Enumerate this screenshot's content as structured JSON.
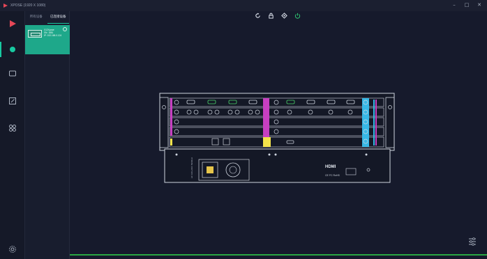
{
  "window": {
    "title": "XPOSE (1920 X 1080)",
    "controls": [
      "–",
      "□",
      "✕"
    ]
  },
  "colors": {
    "accent": "#18c9a1",
    "card": "#1ea88a",
    "status_line": "#2aa843",
    "magenta": "#c73fc1",
    "yellow": "#f3e34a",
    "cyan": "#37b8e6",
    "green_port": "#4bd16a"
  },
  "sidebar": {
    "items": [
      {
        "icon": "play-logo-icon"
      },
      {
        "icon": "device-dot-icon",
        "active": true
      },
      {
        "icon": "screen-icon"
      },
      {
        "icon": "edit-icon"
      },
      {
        "icon": "grid-icon"
      },
      {
        "icon": "settings-gear-icon"
      }
    ]
  },
  "device_panel": {
    "tabs": [
      "所有设备",
      "已连接设备"
    ],
    "device": {
      "name": "X12Xpose",
      "line2": "SN: 1881",
      "line3": "IP: 192.168.0.124"
    }
  },
  "toolbar": {
    "buttons": [
      "refresh-icon",
      "lock-icon",
      "connect-icon",
      "power-icon"
    ]
  },
  "chassis": {
    "logo": "HDMI",
    "compliance": "CE FC RoHS",
    "power_label": "AC 100-240V 50/60Hz"
  }
}
